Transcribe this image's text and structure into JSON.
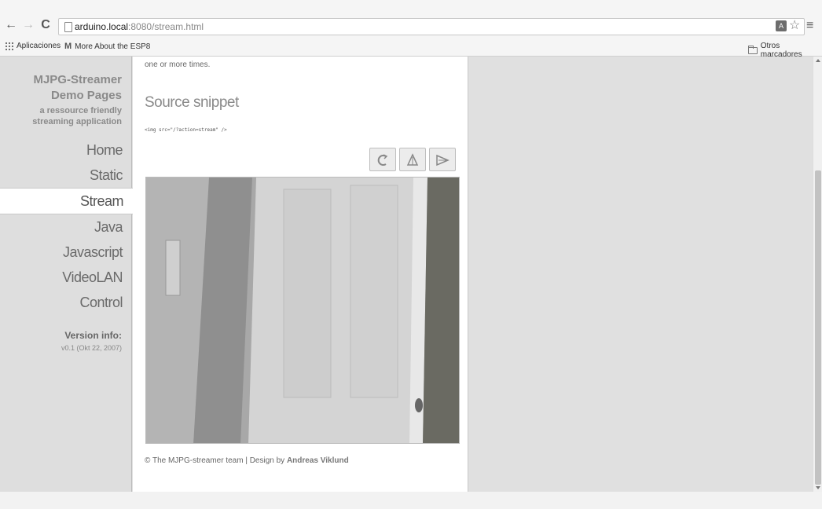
{
  "browser": {
    "url_host": "arduino.local",
    "url_rest": ":8080/stream.html",
    "bookmarks": {
      "apps_label": "Aplicaciones",
      "gmail_label": "More About the ESP8",
      "other_label": "Otros marcadores"
    },
    "icons": [
      "back-icon",
      "forward-icon",
      "reload-icon",
      "page-icon",
      "translate-icon",
      "star-icon",
      "menu-icon"
    ]
  },
  "sidebar": {
    "title": "MJPG-Streamer Demo Pages",
    "title_line1": "MJPG-Streamer",
    "title_line2": "Demo Pages",
    "subtitle_line1": "a ressource friendly",
    "subtitle_line2": "streaming application",
    "nav": [
      {
        "label": "Home"
      },
      {
        "label": "Static"
      },
      {
        "label": "Stream",
        "active": true
      },
      {
        "label": "Java"
      },
      {
        "label": "Javascript"
      },
      {
        "label": "VideoLAN"
      },
      {
        "label": "Control"
      }
    ],
    "version_title": "Version info:",
    "version_value": "v0.1 (Okt 22, 2007)"
  },
  "main": {
    "intro_text": "one or more times.",
    "snippet_title": "Source snippet",
    "code": "<img src=\"/?action=stream\" />",
    "controls": [
      "rotate-icon",
      "flip-icon",
      "mirror-icon"
    ],
    "footer_prefix": "© The MJPG-streamer team | Design by ",
    "footer_author": "Andreas Viklund"
  },
  "colors": {
    "sidebar_bg": "#dedede",
    "content_bg": "#ffffff",
    "text_gray": "#8a8a8a"
  }
}
